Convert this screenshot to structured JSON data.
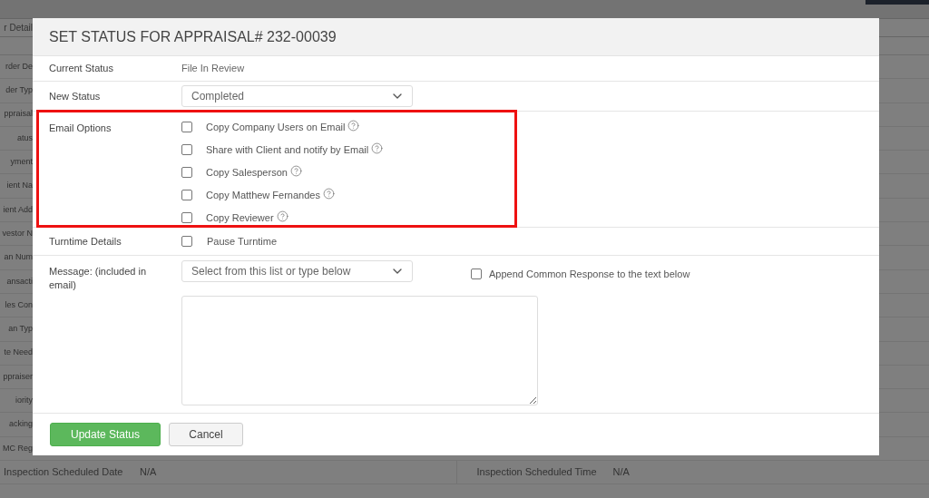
{
  "background": {
    "left_labels": [
      "r Detail",
      "rder De",
      "der Typ",
      "ppraisal",
      "atus",
      "yment",
      "ient Na",
      "ient Add",
      "vestor N",
      "an Num",
      "ansacti",
      "les Con",
      "an Typ",
      "te Need",
      "ppraiser",
      "iority",
      "acking",
      "MC Reg"
    ],
    "bottom_row": [
      {
        "label": "Inspection Scheduled Date",
        "value": "N/A"
      },
      {
        "label": "Inspection Scheduled Time",
        "value": "N/A"
      }
    ]
  },
  "dialog": {
    "title": "SET STATUS FOR APPRAISAL# 232-00039",
    "current_status": {
      "label": "Current Status",
      "value": "File In Review"
    },
    "new_status": {
      "label": "New Status",
      "value": "Completed"
    },
    "email_options": {
      "label": "Email Options",
      "options": [
        {
          "label": "Copy Company Users on Email",
          "checked": false
        },
        {
          "label": "Share with Client and notify by Email",
          "checked": false
        },
        {
          "label": "Copy Salesperson",
          "checked": false
        },
        {
          "label": "Copy Matthew Fernandes",
          "checked": false
        },
        {
          "label": "Copy Reviewer",
          "checked": false
        }
      ]
    },
    "turntime": {
      "label": "Turntime Details",
      "option": {
        "label": "Pause Turntime",
        "checked": false
      }
    },
    "message": {
      "label": "Message: (included in email)",
      "placeholder": "Select from this list or type below",
      "append": {
        "label": "Append Common Response to the text below",
        "checked": false
      }
    },
    "buttons": [
      {
        "label": "Update Status",
        "kind": "primary"
      },
      {
        "label": "Cancel",
        "kind": "secondary"
      }
    ]
  }
}
